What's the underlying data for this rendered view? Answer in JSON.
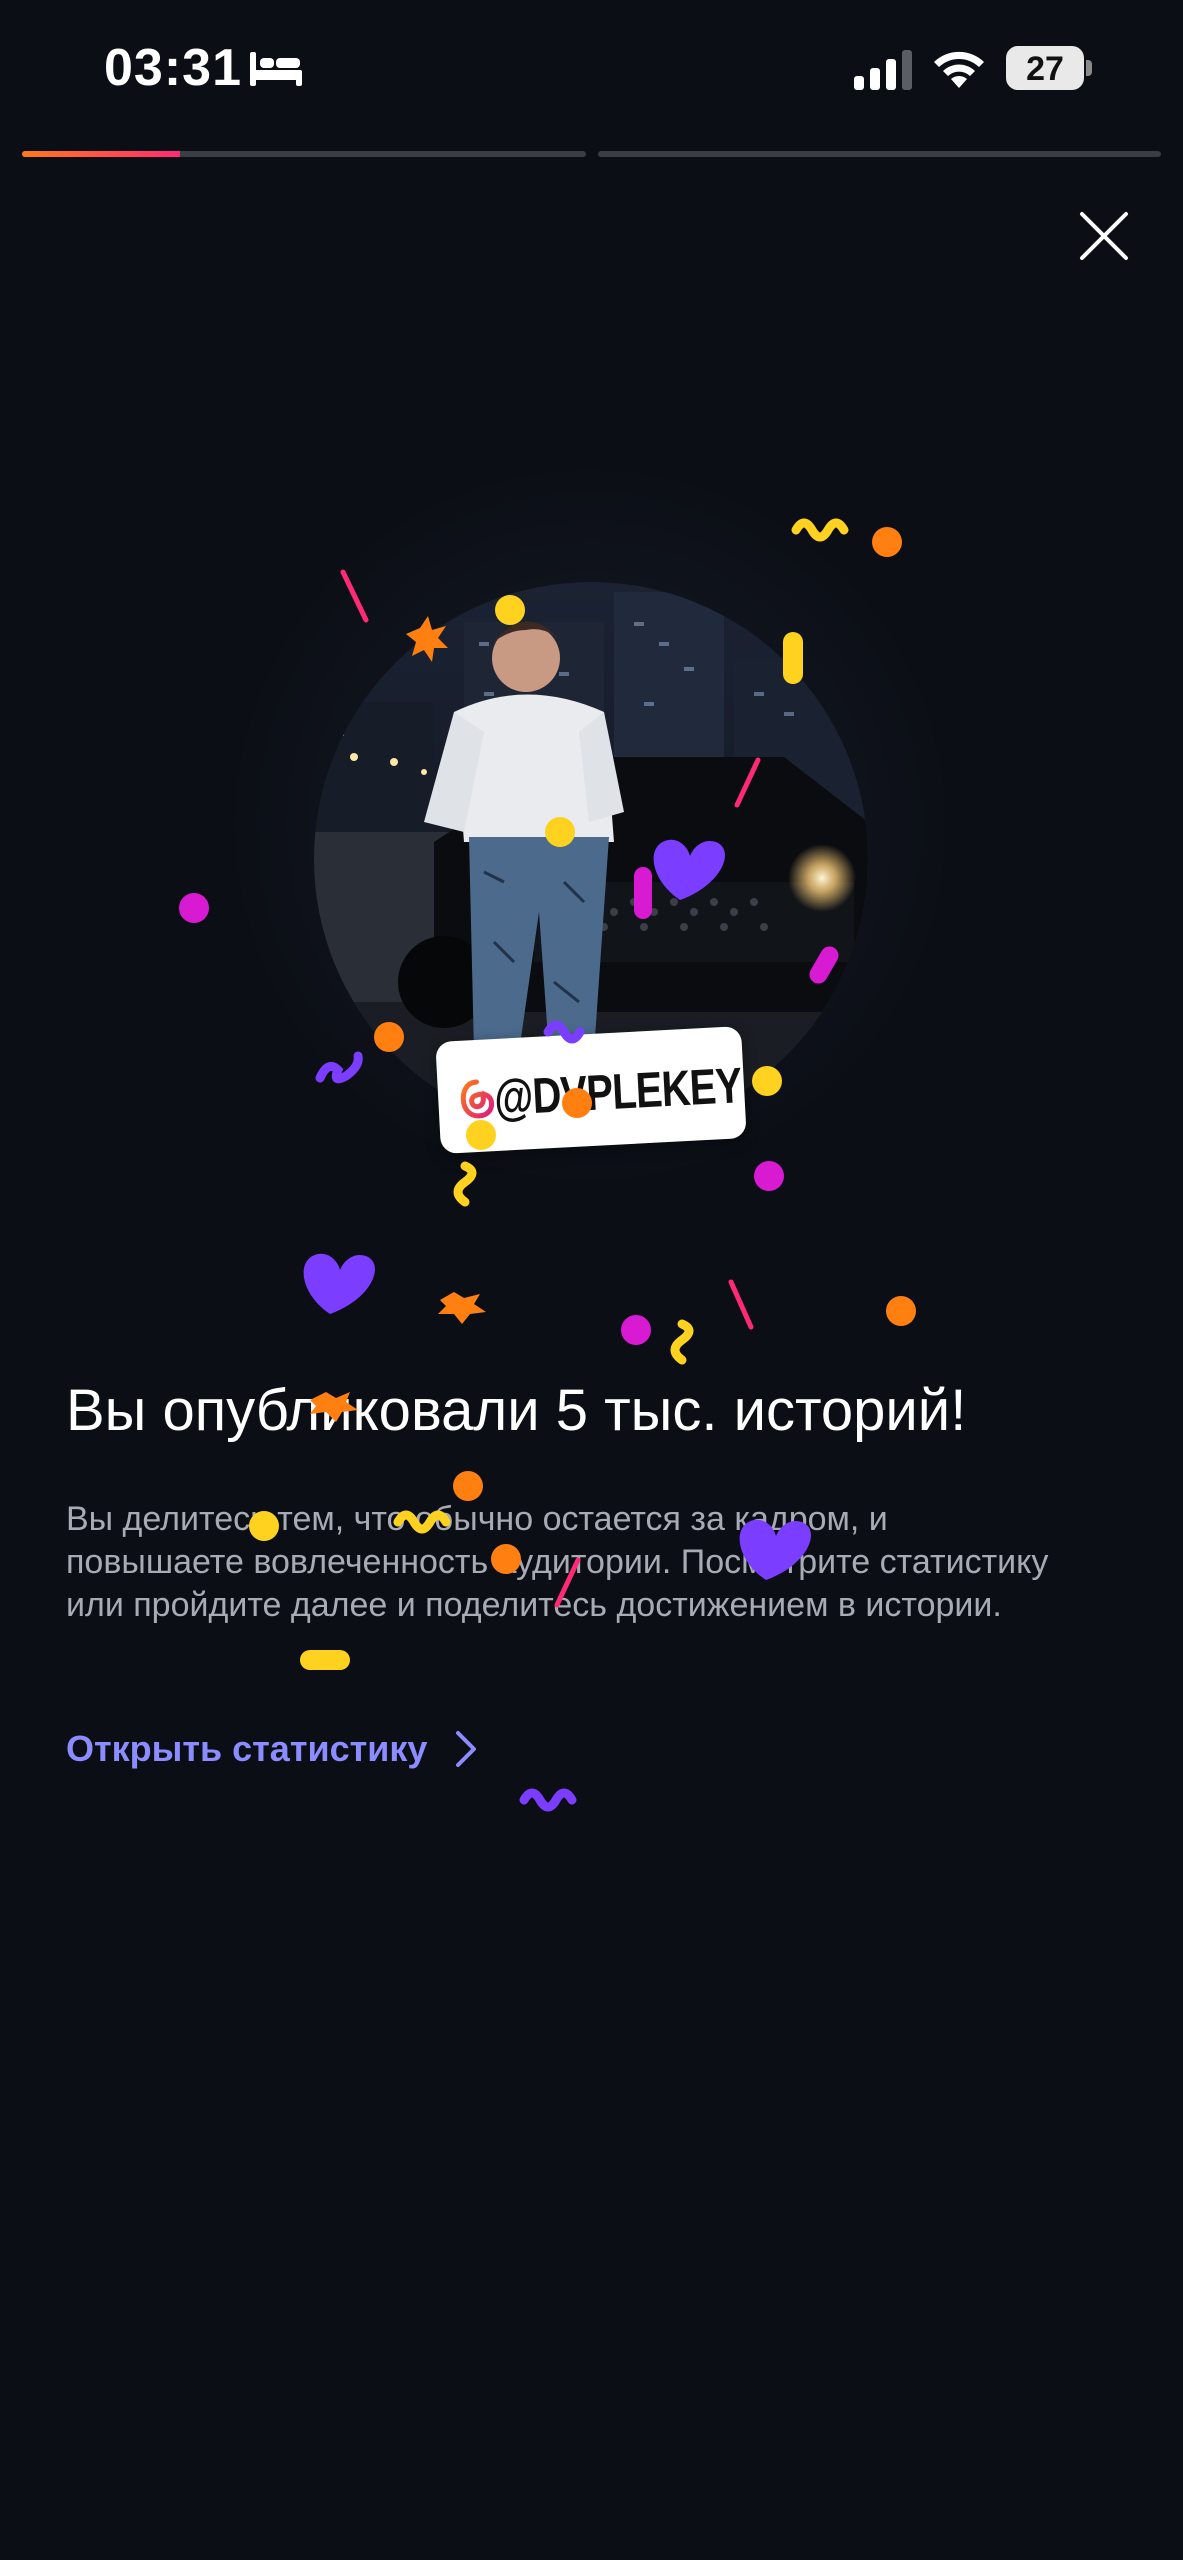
{
  "status_bar": {
    "time": "03:31",
    "battery_level": "27",
    "icons": [
      "bed-icon",
      "cellular-signal-icon",
      "wifi-icon",
      "battery-icon"
    ]
  },
  "story_progress": {
    "segments": [
      {
        "progress": 0.28
      },
      {
        "progress": 0
      }
    ],
    "fill_gradient": [
      "#ff7a1a",
      "#ff2a74"
    ]
  },
  "close_icon": "close-icon",
  "achievement": {
    "username": "@DVPLEKEY",
    "headline": "Вы опубликовали 5 тыс. историй!",
    "description": "Вы делитесь тем, что обычно остается за кадром, и повышаете вовлеченность аудитории. Посмотрите статистику или пройдите далее и поделитесь достижением в истории.",
    "link_label": "Открыть статистику",
    "link_icon": "chevron-right-icon"
  },
  "colors": {
    "background": "#0b0e14",
    "accent_link": "#8b8cff",
    "body_text": "#a7abb3",
    "confetti": [
      "#ffd21f",
      "#ff7f11",
      "#d81ad2",
      "#7b3dff",
      "#ff2a74"
    ]
  }
}
